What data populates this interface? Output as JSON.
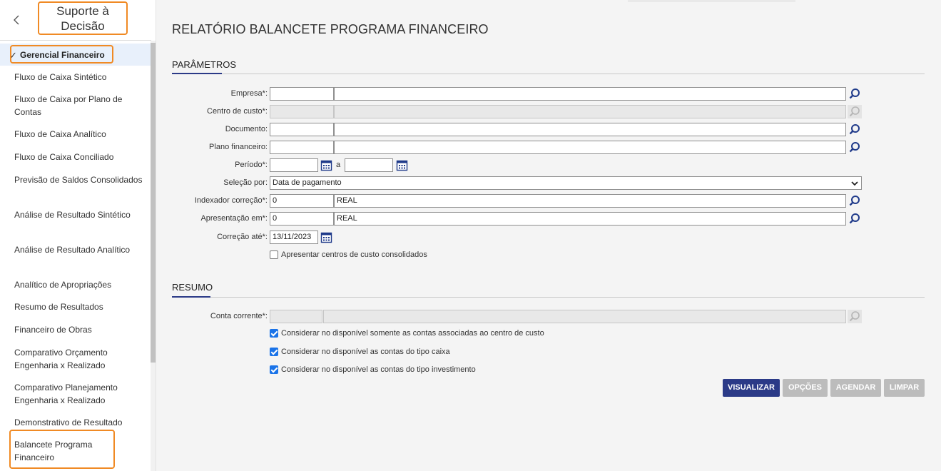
{
  "sidebar": {
    "title": "Suporte à Decisão",
    "active_group": "Gerencial Financeiro",
    "items": [
      "Fluxo de Caixa Sintético",
      "Fluxo de Caixa por Plano de Contas",
      "Fluxo de Caixa Analítico",
      "Fluxo de Caixa Conciliado",
      "Previsão de Saldos Consolidados",
      "Análise de Resultado Sintético",
      "Análise de Resultado Analítico",
      "Analítico de Apropriações",
      "Resumo de Resultados",
      "Financeiro de Obras",
      "Comparativo Orçamento Engenharia x Realizado",
      "Comparativo Planejamento Engenharia x Realizado",
      "Demonstrativo de Resultado",
      "Balancete Programa Financeiro"
    ]
  },
  "page": {
    "title": "RELATÓRIO BALANCETE PROGRAMA FINANCEIRO"
  },
  "params": {
    "section": "PARÂMETROS",
    "empresa_label": "Empresa*:",
    "centro_label": "Centro de custo*:",
    "documento_label": "Documento:",
    "plano_label": "Plano financeiro:",
    "periodo_label": "Período*:",
    "periodo_sep": "a",
    "selecao_label": "Seleção por:",
    "selecao_value": "Data de pagamento",
    "indexador_label": "Indexador correção*:",
    "indexador_code": "0",
    "indexador_name": "REAL",
    "apresentacao_label": "Apresentação em*:",
    "apresentacao_code": "0",
    "apresentacao_name": "REAL",
    "correcao_label": "Correção até*:",
    "correcao_value": "13/11/2023",
    "consolidados_label": "Apresentar centros de custo consolidados",
    "consolidados_checked": false
  },
  "resumo": {
    "section": "RESUMO",
    "conta_label": "Conta corrente*:",
    "check1_label": "Considerar no disponível somente as contas associadas ao centro de custo",
    "check2_label": "Considerar no disponível as contas do tipo caixa",
    "check3_label": "Considerar no disponível as contas do tipo investimento",
    "check1": true,
    "check2": true,
    "check3": true
  },
  "buttons": {
    "visualizar": "VISUALIZAR",
    "opcoes": "OPÇÕES",
    "agendar": "AGENDAR",
    "limpar": "LIMPAR"
  },
  "colors": {
    "accent": "#2b3a87",
    "highlight": "#f08a24",
    "checkbox": "#1a73e8"
  }
}
